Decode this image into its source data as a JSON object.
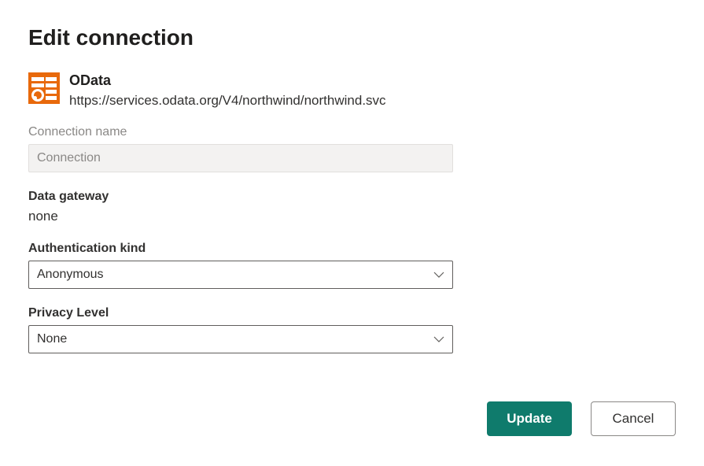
{
  "page": {
    "title": "Edit connection"
  },
  "connector": {
    "name": "OData",
    "url": "https://services.odata.org/V4/northwind/northwind.svc"
  },
  "fields": {
    "connection_name": {
      "label": "Connection name",
      "placeholder": "Connection",
      "value": ""
    },
    "data_gateway": {
      "label": "Data gateway",
      "value": "none"
    },
    "authentication_kind": {
      "label": "Authentication kind",
      "selected": "Anonymous"
    },
    "privacy_level": {
      "label": "Privacy Level",
      "selected": "None"
    }
  },
  "buttons": {
    "update": "Update",
    "cancel": "Cancel"
  }
}
